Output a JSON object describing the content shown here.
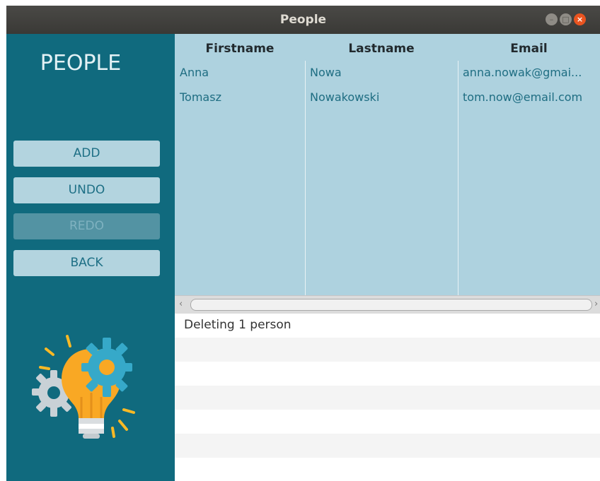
{
  "window": {
    "title": "People",
    "minimize_icon": "minimize-icon",
    "maximize_icon": "maximize-icon",
    "close_icon": "close-icon"
  },
  "sidebar": {
    "title": "PEOPLE",
    "buttons": [
      {
        "label": "ADD",
        "enabled": true
      },
      {
        "label": "UNDO",
        "enabled": true
      },
      {
        "label": "REDO",
        "enabled": false
      },
      {
        "label": "BACK",
        "enabled": true
      }
    ],
    "illustration_icon": "lightbulb-gears-icon"
  },
  "table": {
    "columns": [
      "Firstname",
      "Lastname",
      "Email"
    ],
    "rows": [
      {
        "firstname": "Anna",
        "lastname": "Nowa",
        "email": "anna.nowak@gmai..."
      },
      {
        "firstname": "Tomasz",
        "lastname": "Nowakowski",
        "email": "tom.now@email.com"
      }
    ]
  },
  "log": {
    "entries": [
      "Deleting 1 person"
    ]
  },
  "colors": {
    "sidebar_bg": "#106a7e",
    "table_bg": "#aed2df",
    "button_bg": "#b3d4df",
    "button_text": "#1d6f85",
    "close_button": "#e95420"
  }
}
